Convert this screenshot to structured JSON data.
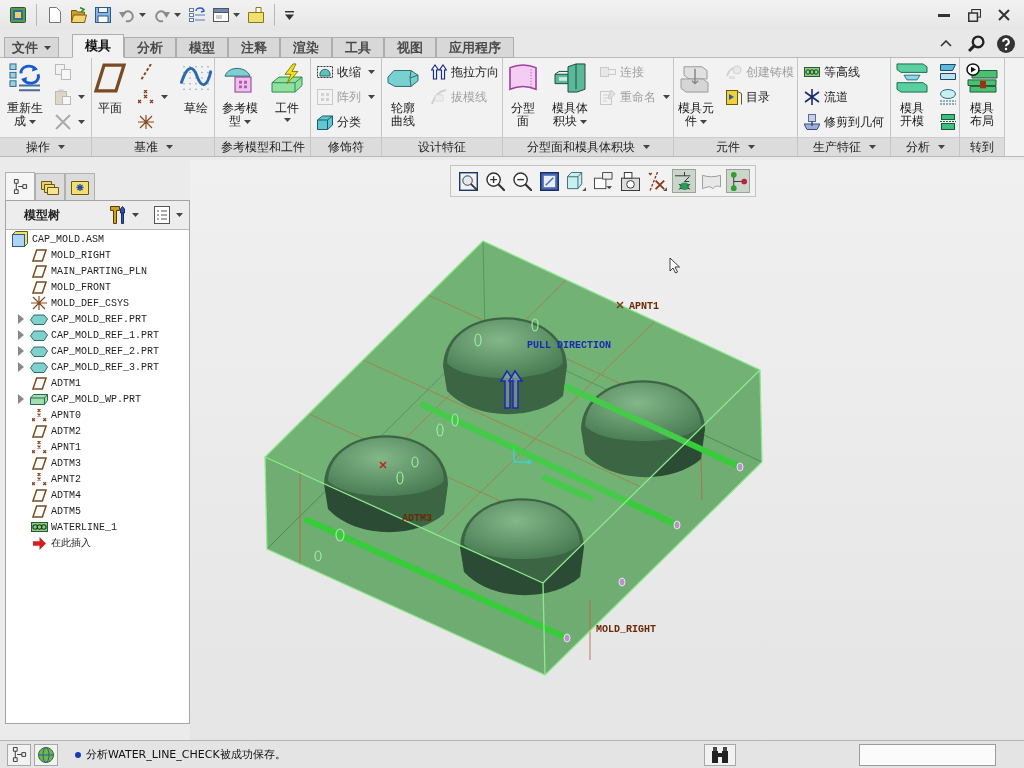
{
  "ribbon": {
    "tabs": [
      {
        "label": "文件",
        "kind": "menu",
        "selected": false
      },
      {
        "label": "模具",
        "kind": "tab",
        "selected": true
      },
      {
        "label": "分析",
        "kind": "tab",
        "selected": false
      },
      {
        "label": "模型",
        "kind": "tab",
        "selected": false
      },
      {
        "label": "注释",
        "kind": "tab",
        "selected": false
      },
      {
        "label": "渲染",
        "kind": "tab",
        "selected": false
      },
      {
        "label": "工具",
        "kind": "tab",
        "selected": false
      },
      {
        "label": "视图",
        "kind": "tab",
        "selected": false
      },
      {
        "label": "应用程序",
        "kind": "tab",
        "selected": false
      }
    ],
    "groups": [
      {
        "label": "操作",
        "menu": true,
        "columns": [
          {
            "kind": "large",
            "label": "重新生成",
            "dropdown": true,
            "disabled": false
          },
          {
            "kind": "stack",
            "items": [
              {
                "dropdown": false,
                "disabled": true
              },
              {
                "dropdown": true,
                "disabled": true
              },
              {
                "dropdown": true,
                "disabled": true
              }
            ]
          }
        ]
      },
      {
        "label": "基准",
        "menu": true,
        "columns": [
          {
            "kind": "large",
            "label": "平面",
            "dropdown": false,
            "disabled": false
          },
          {
            "kind": "stack",
            "items": [
              {
                "dropdown": false,
                "disabled": false
              },
              {
                "dropdown": true,
                "disabled": false
              },
              {
                "dropdown": false,
                "disabled": false
              }
            ]
          },
          {
            "kind": "large",
            "label": "草绘",
            "dropdown": false,
            "disabled": false
          }
        ]
      },
      {
        "label": "参考模型和工件",
        "menu": false,
        "columns": [
          {
            "kind": "large",
            "label": "参考模型",
            "dropdown": true,
            "disabled": false
          },
          {
            "kind": "large",
            "label": "工件",
            "dropdown": true,
            "disabled": false
          }
        ]
      },
      {
        "label": "修饰符",
        "menu": false,
        "columns": [
          {
            "kind": "stack",
            "items": [
              {
                "label": "收缩",
                "dropdown": true,
                "disabled": false
              },
              {
                "label": "阵列",
                "dropdown": true,
                "disabled": true
              },
              {
                "label": "分类",
                "dropdown": false,
                "disabled": false
              }
            ]
          }
        ]
      },
      {
        "label": "设计特征",
        "menu": false,
        "columns": [
          {
            "kind": "large",
            "label": "轮廓曲线",
            "dropdown": false,
            "disabled": false
          },
          {
            "kind": "stack",
            "items": [
              {
                "label": "拖拉方向",
                "dropdown": false,
                "disabled": false
              },
              {
                "label": "拔模线",
                "dropdown": false,
                "disabled": true
              }
            ]
          }
        ]
      },
      {
        "label": "分型面和模具体积块",
        "menu": true,
        "columns": [
          {
            "kind": "large",
            "label": "分型面",
            "dropdown": false,
            "disabled": false
          },
          {
            "kind": "large",
            "label": "模具体积块",
            "dropdown": true,
            "disabled": false
          },
          {
            "kind": "stack",
            "items": [
              {
                "label": "连接",
                "dropdown": false,
                "disabled": true
              },
              {
                "label": "重命名",
                "dropdown": true,
                "disabled": true
              }
            ]
          }
        ]
      },
      {
        "label": "元件",
        "menu": true,
        "columns": [
          {
            "kind": "large",
            "label": "模具元件",
            "dropdown": true,
            "disabled": false
          },
          {
            "kind": "stack",
            "items": [
              {
                "label": "创建铸模",
                "dropdown": false,
                "disabled": true
              },
              {
                "label": "目录",
                "dropdown": false,
                "disabled": false
              }
            ]
          }
        ]
      },
      {
        "label": "生产特征",
        "menu": true,
        "columns": [
          {
            "kind": "stack",
            "items": [
              {
                "label": "等高线",
                "dropdown": false,
                "disabled": false
              },
              {
                "label": "流道",
                "dropdown": false,
                "disabled": false
              },
              {
                "label": "修剪到几何",
                "dropdown": false,
                "disabled": false
              }
            ]
          }
        ]
      },
      {
        "label": "分析",
        "menu": true,
        "columns": [
          {
            "kind": "large",
            "label": "模具开模",
            "dropdown": false,
            "disabled": false
          },
          {
            "kind": "stack",
            "items": [
              {
                "disabled": false
              },
              {
                "disabled": false
              },
              {
                "disabled": false
              }
            ]
          }
        ]
      },
      {
        "label": "转到",
        "menu": false,
        "columns": [
          {
            "kind": "large",
            "label": "模具布局",
            "dropdown": false,
            "disabled": false
          }
        ]
      }
    ]
  },
  "model_tree": {
    "tabs": [
      {
        "selected": true
      },
      {
        "selected": false
      },
      {
        "selected": false
      }
    ],
    "title": "模型树",
    "root": {
      "label": "CAP_MOLD.ASM",
      "kind": "assembly",
      "children": [
        {
          "label": "MOLD_RIGHT",
          "kind": "datum_plane",
          "collapsed": false
        },
        {
          "label": "MAIN_PARTING_PLN",
          "kind": "datum_plane",
          "collapsed": false
        },
        {
          "label": "MOLD_FRONT",
          "kind": "datum_plane",
          "collapsed": false
        },
        {
          "label": "MOLD_DEF_CSYS",
          "kind": "csys",
          "collapsed": false
        },
        {
          "label": "CAP_MOLD_REF.PRT",
          "kind": "reference_part",
          "collapsed": true
        },
        {
          "label": "CAP_MOLD_REF_1.PRT",
          "kind": "reference_part",
          "collapsed": true
        },
        {
          "label": "CAP_MOLD_REF_2.PRT",
          "kind": "reference_part",
          "collapsed": true
        },
        {
          "label": "CAP_MOLD_REF_3.PRT",
          "kind": "reference_part",
          "collapsed": true
        },
        {
          "label": "ADTM1",
          "kind": "datum_plane",
          "collapsed": false
        },
        {
          "label": "CAP_MOLD_WP.PRT",
          "kind": "workpiece",
          "collapsed": true
        },
        {
          "label": "APNT0",
          "kind": "datum_point",
          "collapsed": false
        },
        {
          "label": "ADTM2",
          "kind": "datum_plane",
          "collapsed": false
        },
        {
          "label": "APNT1",
          "kind": "datum_point",
          "collapsed": false
        },
        {
          "label": "ADTM3",
          "kind": "datum_plane",
          "collapsed": false
        },
        {
          "label": "APNT2",
          "kind": "datum_point",
          "collapsed": false
        },
        {
          "label": "ADTM4",
          "kind": "datum_plane",
          "collapsed": false
        },
        {
          "label": "ADTM5",
          "kind": "datum_plane",
          "collapsed": false
        },
        {
          "label": "WATERLINE_1",
          "kind": "waterline",
          "collapsed": false
        },
        {
          "label": "在此插入",
          "kind": "insert_marker",
          "collapsed": false
        }
      ]
    }
  },
  "view_toolbar": {
    "buttons": [
      {
        "selected": false
      },
      {
        "selected": false
      },
      {
        "selected": false
      },
      {
        "selected": false
      },
      {
        "selected": false
      },
      {
        "selected": false
      },
      {
        "selected": false
      },
      {
        "selected": false
      },
      {
        "selected": true
      },
      {
        "selected": false
      },
      {
        "selected": true
      }
    ]
  },
  "viewport": {
    "labels": [
      {
        "kind": "datum",
        "text": "APNT1"
      },
      {
        "kind": "direction",
        "text": "PULL DIRECTION"
      },
      {
        "kind": "datum",
        "text": "ADTM3"
      },
      {
        "kind": "datum",
        "text": "MOLD_RIGHT"
      }
    ]
  },
  "status_bar": {
    "message": "分析WATER_LINE_CHECK被成功保存。"
  }
}
